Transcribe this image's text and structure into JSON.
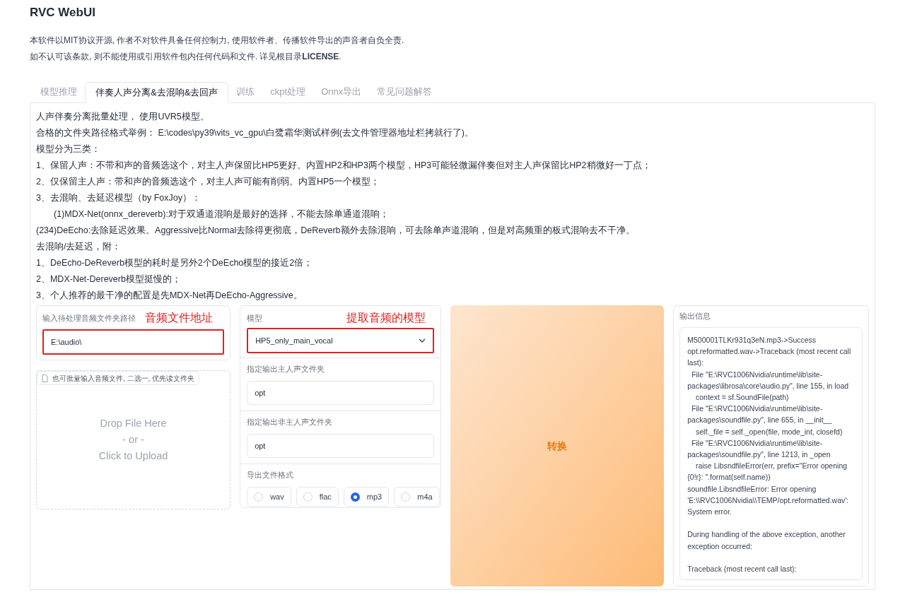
{
  "title": "RVC WebUI",
  "notice": [
    "本软件以MIT协议开源, 作者不对软件具备任何控制力, 使用软件者、传播软件导出的声音者自负全责.",
    "如不认可该条款, 则不能使用或引用软件包内任何代码和文件. 详见根目录**LICENSE**."
  ],
  "tabs": [
    {
      "label": "模型推理",
      "selected": false
    },
    {
      "label": "伴奏人声分离&去混响&去回声",
      "selected": true
    },
    {
      "label": "训练",
      "selected": false
    },
    {
      "label": "ckpt处理",
      "selected": false
    },
    {
      "label": "Onnx导出",
      "selected": false
    },
    {
      "label": "常见问题解答",
      "selected": false
    }
  ],
  "intro": [
    {
      "text": "人声伴奏分离批量处理， 使用UVR5模型。",
      "indent": false
    },
    {
      "text": "合格的文件夹路径格式举例： E:\\codes\\py39\\vits_vc_gpu\\白鹭霜华测试样例(去文件管理器地址栏拷就行了)。",
      "indent": false
    },
    {
      "text": "模型分为三类：",
      "indent": false
    },
    {
      "text": "1、保留人声：不带和声的音频选这个，对主人声保留比HP5更好。内置HP2和HP3两个模型，HP3可能轻微漏伴奏但对主人声保留比HP2稍微好一丁点；",
      "indent": false
    },
    {
      "text": "2、仅保留主人声：带和声的音频选这个，对主人声可能有削弱。内置HP5一个模型；",
      "indent": false
    },
    {
      "text": "3、去混响、去延迟模型（by FoxJoy）：",
      "indent": false
    },
    {
      "text": "(1)MDX-Net(onnx_dereverb):对于双通道混响是最好的选择，不能去除单通道混响；",
      "indent": true
    },
    {
      "text": "(234)DeEcho:去除延迟效果。Aggressive比Normal去除得更彻底，DeReverb额外去除混响，可去除单声道混响，但是对高频重的板式混响去不干净。",
      "indent": false
    },
    {
      "text": "去混响/去延迟，附：",
      "indent": false
    },
    {
      "text": "1、DeEcho-DeReverb模型的耗时是另外2个DeEcho模型的接近2倍；",
      "indent": false
    },
    {
      "text": "2、MDX-Net-Dereverb模型挺慢的；",
      "indent": false
    },
    {
      "text": "3、个人推荐的最干净的配置是先MDX-Net再DeEcho-Aggressive。",
      "indent": false
    }
  ],
  "folder_input": {
    "label": "输入待处理音频文件夹路径",
    "value": "E:\\audio\\",
    "annotation": "音频文件地址"
  },
  "upload": {
    "label": "也可批量输入音频文件, 二选一, 优先读文件夹",
    "lines": [
      "Drop File Here",
      "- or -",
      "Click to Upload"
    ]
  },
  "model": {
    "label": "模型",
    "value": "HP5_only_main_vocal",
    "annotation": "提取音频的模型"
  },
  "vocal_folder": {
    "label": "指定输出主人声文件夹",
    "value": "opt"
  },
  "other_folder": {
    "label": "指定输出非主人声文件夹",
    "value": "opt"
  },
  "format": {
    "label": "导出文件格式",
    "options": [
      {
        "label": "wav",
        "selected": false
      },
      {
        "label": "flac",
        "selected": false
      },
      {
        "label": "mp3",
        "selected": true
      },
      {
        "label": "m4a",
        "selected": false
      }
    ]
  },
  "convert_button": "转换",
  "output": {
    "label": "输出信息",
    "value": "M500001TLKr931q3eN.mp3->Success\nopt.reformatted.wav->Traceback (most recent call last):\n  File \"E:\\RVC1006Nvidia\\runtime\\lib\\site-packages\\librosa\\core\\audio.py\", line 155, in load\n    context = sf.SoundFile(path)\n  File \"E:\\RVC1006Nvidia\\runtime\\lib\\site-packages\\soundfile.py\", line 655, in __init__\n    self._file = self._open(file, mode_int, closefd)\n  File \"E:\\RVC1006Nvidia\\runtime\\lib\\site-packages\\soundfile.py\", line 1213, in _open\n    raise LibsndfileError(err, prefix=\"Error opening {0!r}: \".format(self.name))\nsoundfile.LibsndfileError: Error opening 'E:\\\\RVC1006Nvidia\\\\TEMP/opt.reformatted.wav': System error.\n\nDuring handling of the above exception, another exception occurred:\n\nTraceback (most recent call last):"
  }
}
